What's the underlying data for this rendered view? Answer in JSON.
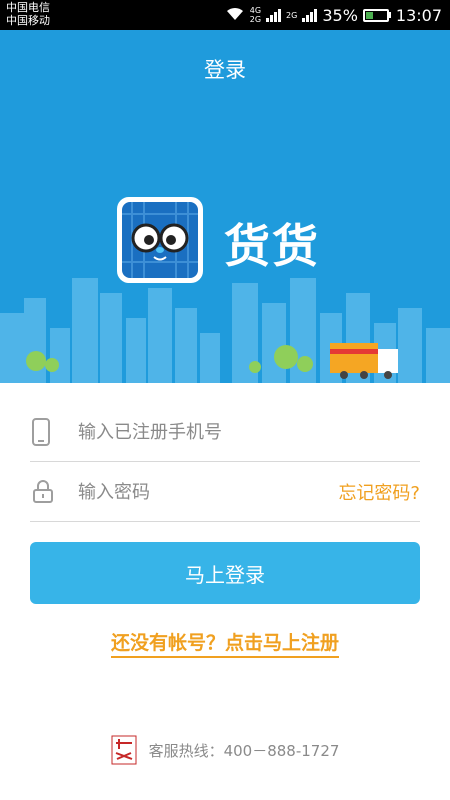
{
  "status_bar": {
    "carrier_1": "中国电信",
    "carrier_2": "中国移动",
    "net_1": "4G",
    "net_2": "2G",
    "net_3": "2G",
    "battery": "35%",
    "time": "13:07"
  },
  "header": {
    "title": "登录"
  },
  "brand": {
    "name": "货货"
  },
  "form": {
    "phone_placeholder": "输入已注册手机号",
    "password_placeholder": "输入密码",
    "forgot_label": "忘记密码?",
    "login_label": "马上登录",
    "register_label": "还没有帐号？点击马上注册"
  },
  "footer": {
    "hotline": "客服热线：400－888-1727"
  },
  "colors": {
    "primary": "#1f9bdc",
    "button": "#37b4e8",
    "accent_orange": "#f0a020",
    "battery_green": "#4caf50"
  }
}
